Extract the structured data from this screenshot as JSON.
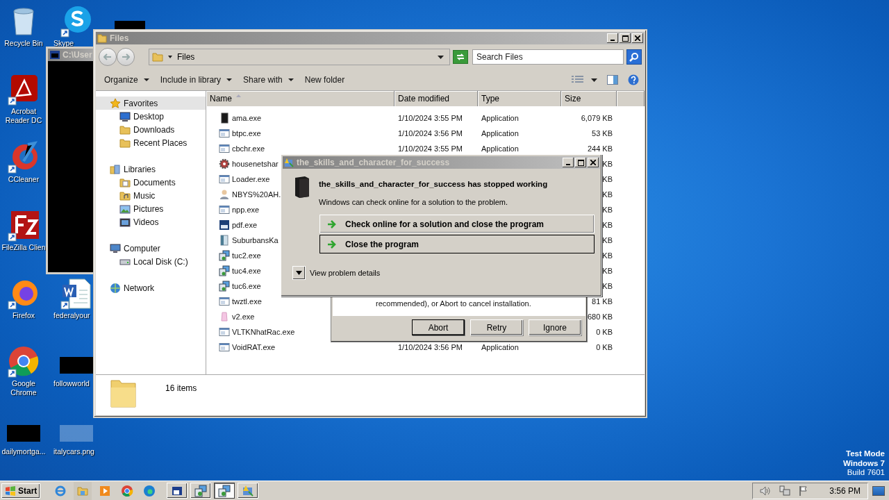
{
  "desktop": {
    "columns": [
      [
        {
          "label": "Recycle Bin",
          "kind": "recycle"
        },
        {
          "label": "Acrobat Reader DC",
          "kind": "acrobat"
        },
        {
          "label": "CCleaner",
          "kind": "ccleaner"
        },
        {
          "label": "FileZilla Clien",
          "kind": "filezilla"
        },
        {
          "label": "Firefox",
          "kind": "firefox"
        },
        {
          "label": "Google Chrome",
          "kind": "chrome"
        },
        {
          "label": "dailymortga...",
          "kind": "dark-thumb"
        }
      ],
      [
        {
          "label": "Skype",
          "kind": "skype"
        },
        {
          "label": "federalyour",
          "kind": "word"
        },
        {
          "label": "followworld",
          "kind": "dark-thumb"
        },
        {
          "label": "italycars.png",
          "kind": "light-thumb"
        }
      ]
    ],
    "system_info": [
      "Test Mode",
      "Windows 7",
      "Build 7601"
    ]
  },
  "console_window": {
    "title": "C:\\User"
  },
  "explorer": {
    "title": "Files",
    "address": "Files",
    "search": {
      "placeholder": "Search Files"
    },
    "toolbar": [
      {
        "label": "Organize",
        "dropdown": true
      },
      {
        "label": "Include in library",
        "dropdown": true
      },
      {
        "label": "Share with",
        "dropdown": true
      },
      {
        "label": "New folder",
        "dropdown": false
      }
    ],
    "nav": [
      {
        "label": "Favorites",
        "kind": "star",
        "selected": true,
        "children": [
          {
            "label": "Desktop",
            "kind": "desktop",
            "selected": false
          },
          {
            "label": "Downloads",
            "kind": "downloads",
            "selected": false
          },
          {
            "label": "Recent Places",
            "kind": "recent",
            "selected": false
          }
        ]
      },
      {
        "label": "Libraries",
        "kind": "library",
        "selected": false,
        "children": [
          {
            "label": "Documents",
            "kind": "documents",
            "selected": false
          },
          {
            "label": "Music",
            "kind": "music",
            "selected": false
          },
          {
            "label": "Pictures",
            "kind": "pictures",
            "selected": false
          },
          {
            "label": "Videos",
            "kind": "videos",
            "selected": false
          }
        ]
      },
      {
        "label": "Computer",
        "kind": "computer",
        "selected": false,
        "children": [
          {
            "label": "Local Disk (C:)",
            "kind": "disk",
            "selected": false
          }
        ]
      },
      {
        "label": "Network",
        "kind": "network",
        "selected": false
      }
    ],
    "columns": [
      "Name",
      "Date modified",
      "Type",
      "Size"
    ],
    "rows": [
      {
        "name": "ama.exe",
        "kind": "box",
        "date": "1/10/2024 3:55 PM",
        "type": "Application",
        "size": "6,079 KB"
      },
      {
        "name": "btpc.exe",
        "kind": "exe",
        "date": "1/10/2024 3:56 PM",
        "type": "Application",
        "size": "53 KB"
      },
      {
        "name": "cbchr.exe",
        "kind": "exe",
        "date": "1/10/2024 3:55 PM",
        "type": "Application",
        "size": "244 KB"
      },
      {
        "name": "housenetshar",
        "kind": "gear",
        "size": "KB"
      },
      {
        "name": "Loader.exe",
        "kind": "exe",
        "size": "KB"
      },
      {
        "name": "NBYS%20AH.",
        "kind": "person",
        "size": "KB"
      },
      {
        "name": "npp.exe",
        "kind": "exe",
        "size": "KB"
      },
      {
        "name": "pdf.exe",
        "kind": "pdf",
        "size": "KB"
      },
      {
        "name": "SuburbansKa",
        "kind": "doc",
        "size": "KB"
      },
      {
        "name": "tuc2.exe",
        "kind": "installer",
        "size": "KB"
      },
      {
        "name": "tuc4.exe",
        "kind": "installer",
        "size": "KB"
      },
      {
        "name": "tuc6.exe",
        "kind": "installer",
        "size": "KB"
      },
      {
        "name": "twztl.exe",
        "kind": "exe",
        "size": "81 KB"
      },
      {
        "name": "v2.exe",
        "kind": "pink",
        "size": "680 KB"
      },
      {
        "name": "VLTKNhatRac.exe",
        "kind": "exe",
        "size": "0 KB"
      },
      {
        "name": "VoidRAT.exe",
        "kind": "exe",
        "date": "1/10/2024 3:56 PM",
        "type": "Application",
        "size": "0 KB"
      }
    ],
    "status": "16 items"
  },
  "message_box": {
    "text": "recommended), or Abort to cancel installation.",
    "buttons": [
      {
        "label": "Abort",
        "default": true
      },
      {
        "label": "Retry",
        "default": false
      },
      {
        "label": "Ignore",
        "default": false
      }
    ]
  },
  "crash_dialog": {
    "title": "the_skills_and_character_for_success",
    "heading": "the_skills_and_character_for_success has stopped working",
    "message": "Windows can check online for a solution to the problem.",
    "options": [
      {
        "label": "Check online for a solution and close the program",
        "focused": false
      },
      {
        "label": "Close the program",
        "focused": true
      }
    ],
    "details": "View problem details"
  },
  "taskbar": {
    "start": "Start",
    "pinned": [
      {
        "kind": "ie"
      },
      {
        "kind": "folder"
      },
      {
        "kind": "media"
      },
      {
        "kind": "chrome"
      },
      {
        "kind": "edge"
      }
    ],
    "tasks": [
      {
        "kind": "console",
        "selected": false
      },
      {
        "kind": "installer",
        "selected": false
      },
      {
        "kind": "installer",
        "selected": true
      },
      {
        "kind": "error",
        "selected": false
      }
    ],
    "clock": "3:56 PM"
  }
}
